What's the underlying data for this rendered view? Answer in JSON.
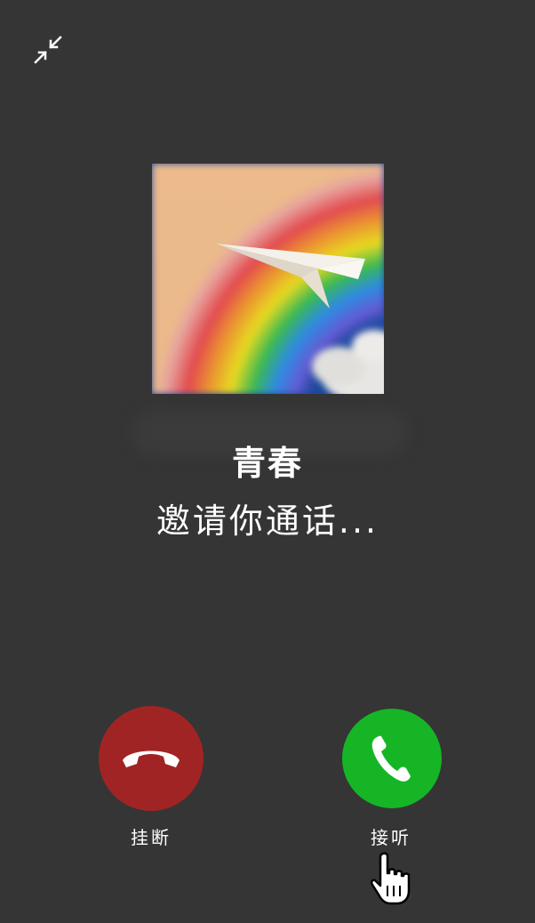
{
  "caller": {
    "name": "青春",
    "status": "邀请你通话..."
  },
  "actions": {
    "hangup_label": "挂断",
    "answer_label": "接听"
  },
  "colors": {
    "background": "#353535",
    "hangup": "#a12424",
    "answer": "#16b526",
    "text": "#ffffff"
  },
  "icons": {
    "minimize": "minimize-arrows-icon",
    "hangup": "phone-hangup-icon",
    "answer": "phone-icon",
    "cursor": "hand-pointer-icon"
  }
}
